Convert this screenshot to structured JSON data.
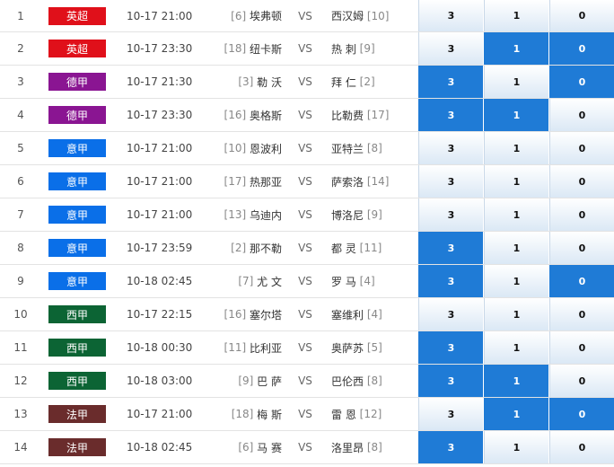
{
  "colors": {
    "epl": "#e0101a",
    "bundesliga": "#8a1592",
    "seriea": "#0a6fe8",
    "laliga": "#0c6434",
    "ligue1": "#6a2c2c",
    "highlight": "#1f7bd6"
  },
  "rows": [
    {
      "idx": "1",
      "league": "英超",
      "lc": "epl",
      "time": "10-17 21:00",
      "home_rank": "[6]",
      "home": "埃弗顿",
      "vs": "VS",
      "away": "西汉姆",
      "away_rank": "[10]",
      "odds": [
        "3",
        "1",
        "0"
      ],
      "hl": [
        false,
        false,
        false
      ]
    },
    {
      "idx": "2",
      "league": "英超",
      "lc": "epl",
      "time": "10-17 23:30",
      "home_rank": "[18]",
      "home": "纽卡斯",
      "vs": "VS",
      "away": "热 刺",
      "away_rank": "[9]",
      "odds": [
        "3",
        "1",
        "0"
      ],
      "hl": [
        false,
        true,
        true
      ]
    },
    {
      "idx": "3",
      "league": "德甲",
      "lc": "bundesliga",
      "time": "10-17 21:30",
      "home_rank": "[3]",
      "home": "勒 沃",
      "vs": "VS",
      "away": "拜 仁",
      "away_rank": "[2]",
      "odds": [
        "3",
        "1",
        "0"
      ],
      "hl": [
        true,
        false,
        true
      ]
    },
    {
      "idx": "4",
      "league": "德甲",
      "lc": "bundesliga",
      "time": "10-17 23:30",
      "home_rank": "[16]",
      "home": "奥格斯",
      "vs": "VS",
      "away": "比勒费",
      "away_rank": "[17]",
      "odds": [
        "3",
        "1",
        "0"
      ],
      "hl": [
        true,
        true,
        false
      ]
    },
    {
      "idx": "5",
      "league": "意甲",
      "lc": "seriea",
      "time": "10-17 21:00",
      "home_rank": "[10]",
      "home": "恩波利",
      "vs": "VS",
      "away": "亚特兰",
      "away_rank": "[8]",
      "odds": [
        "3",
        "1",
        "0"
      ],
      "hl": [
        false,
        false,
        false
      ]
    },
    {
      "idx": "6",
      "league": "意甲",
      "lc": "seriea",
      "time": "10-17 21:00",
      "home_rank": "[17]",
      "home": "热那亚",
      "vs": "VS",
      "away": "萨索洛",
      "away_rank": "[14]",
      "odds": [
        "3",
        "1",
        "0"
      ],
      "hl": [
        false,
        false,
        false
      ]
    },
    {
      "idx": "7",
      "league": "意甲",
      "lc": "seriea",
      "time": "10-17 21:00",
      "home_rank": "[13]",
      "home": "乌迪内",
      "vs": "VS",
      "away": "博洛尼",
      "away_rank": "[9]",
      "odds": [
        "3",
        "1",
        "0"
      ],
      "hl": [
        false,
        false,
        false
      ]
    },
    {
      "idx": "8",
      "league": "意甲",
      "lc": "seriea",
      "time": "10-17 23:59",
      "home_rank": "[2]",
      "home": "那不勒",
      "vs": "VS",
      "away": "都 灵",
      "away_rank": "[11]",
      "odds": [
        "3",
        "1",
        "0"
      ],
      "hl": [
        true,
        false,
        false
      ]
    },
    {
      "idx": "9",
      "league": "意甲",
      "lc": "seriea",
      "time": "10-18 02:45",
      "home_rank": "[7]",
      "home": "尤 文",
      "vs": "VS",
      "away": "罗 马",
      "away_rank": "[4]",
      "odds": [
        "3",
        "1",
        "0"
      ],
      "hl": [
        true,
        false,
        true
      ]
    },
    {
      "idx": "10",
      "league": "西甲",
      "lc": "laliga",
      "time": "10-17 22:15",
      "home_rank": "[16]",
      "home": "塞尔塔",
      "vs": "VS",
      "away": "塞维利",
      "away_rank": "[4]",
      "odds": [
        "3",
        "1",
        "0"
      ],
      "hl": [
        false,
        false,
        false
      ]
    },
    {
      "idx": "11",
      "league": "西甲",
      "lc": "laliga",
      "time": "10-18 00:30",
      "home_rank": "[11]",
      "home": "比利亚",
      "vs": "VS",
      "away": "奥萨苏",
      "away_rank": "[5]",
      "odds": [
        "3",
        "1",
        "0"
      ],
      "hl": [
        true,
        false,
        false
      ]
    },
    {
      "idx": "12",
      "league": "西甲",
      "lc": "laliga",
      "time": "10-18 03:00",
      "home_rank": "[9]",
      "home": "巴 萨",
      "vs": "VS",
      "away": "巴伦西",
      "away_rank": "[8]",
      "odds": [
        "3",
        "1",
        "0"
      ],
      "hl": [
        true,
        true,
        false
      ]
    },
    {
      "idx": "13",
      "league": "法甲",
      "lc": "ligue1",
      "time": "10-17 21:00",
      "home_rank": "[18]",
      "home": "梅 斯",
      "vs": "VS",
      "away": "雷 恩",
      "away_rank": "[12]",
      "odds": [
        "3",
        "1",
        "0"
      ],
      "hl": [
        false,
        true,
        true
      ]
    },
    {
      "idx": "14",
      "league": "法甲",
      "lc": "ligue1",
      "time": "10-18 02:45",
      "home_rank": "[6]",
      "home": "马 赛",
      "vs": "VS",
      "away": "洛里昂",
      "away_rank": "[8]",
      "odds": [
        "3",
        "1",
        "0"
      ],
      "hl": [
        true,
        false,
        false
      ]
    }
  ]
}
